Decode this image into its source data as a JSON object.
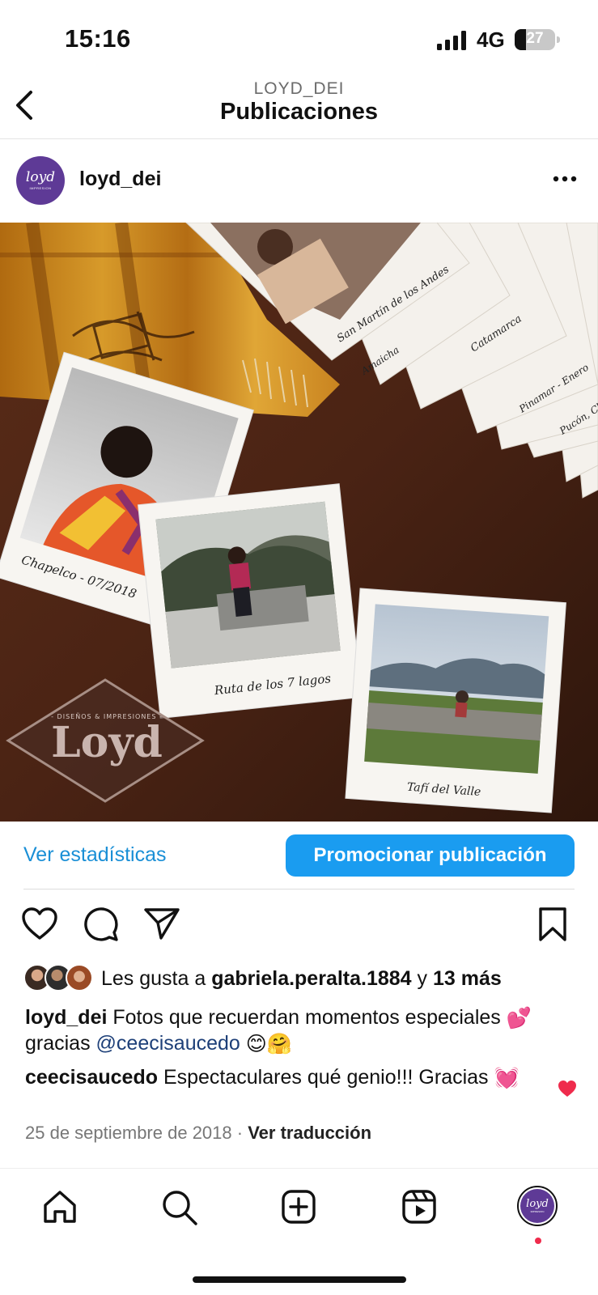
{
  "status_bar": {
    "time": "15:16",
    "network": "4G",
    "battery_level": "27"
  },
  "header": {
    "subtitle": "LOYD_DEI",
    "title": "Publicaciones"
  },
  "post": {
    "avatar_text": "loyd",
    "avatar_subtext": "IMPRESION",
    "username": "loyd_dei",
    "image": {
      "polaroid_captions": [
        "Chapelco - 07/2018",
        "Ruta de los 7 lagos",
        "Tafí del Valle"
      ],
      "stack_captions": [
        "San Martín de los Andes",
        "Amaicha",
        "Catamarca",
        "Pinamar - Enero",
        "Pucón, Ch"
      ],
      "watermark_small": "- DISEÑOS & IMPRESIONES -",
      "watermark_big": "Loyd"
    },
    "actions": {
      "stats_label": "Ver estadísticas",
      "promote_label": "Promocionar publicación"
    },
    "likes": {
      "prefix": "Les gusta a ",
      "user": "gabriela.peralta.1884",
      "connector": " y ",
      "count_text": "13 más"
    },
    "caption": {
      "user": "loyd_dei",
      "text": " Fotos que recuerdan momentos especiales ",
      "emoji1": "💕",
      "text2": " gracias ",
      "mention": "@ceecisaucedo",
      "emoji2": "😊🤗"
    },
    "comment": {
      "user": "ceecisaucedo",
      "text": " Espectaculares qué genio!!! Gracias ",
      "emoji": "💓"
    },
    "date": "25 de septiembre de 2018",
    "separator": " · ",
    "translate_label": "Ver traducción"
  },
  "tab_bar": {
    "items": [
      "home-icon",
      "search-icon",
      "create-icon",
      "reels-icon",
      "profile-avatar"
    ],
    "avatar_text": "loyd",
    "avatar_subtext": "IMPRESION"
  },
  "colors": {
    "accent": "#1a9cf0",
    "link": "#1a8fd6",
    "mention": "#1d3f78",
    "brand_purple": "#5e3a96",
    "notification": "#ef2b4c"
  }
}
